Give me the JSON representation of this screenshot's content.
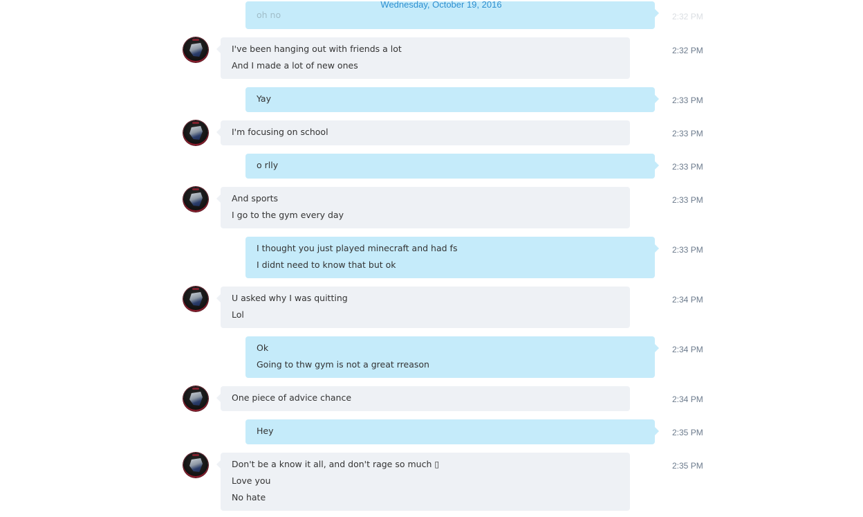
{
  "conversation": {
    "date_header": "Wednesday, October 19, 2016"
  },
  "messages": [
    {
      "dir": "out",
      "lines": [
        "oh no"
      ],
      "time": "2:32 PM"
    },
    {
      "dir": "in",
      "lines": [
        "I've been hanging out with friends a lot",
        "And I made a lot of new ones"
      ],
      "time": "2:32 PM"
    },
    {
      "dir": "out",
      "lines": [
        "Yay"
      ],
      "time": "2:33 PM"
    },
    {
      "dir": "in",
      "lines": [
        "I'm focusing on school"
      ],
      "time": "2:33 PM"
    },
    {
      "dir": "out",
      "lines": [
        "o rlly"
      ],
      "time": "2:33 PM"
    },
    {
      "dir": "in",
      "lines": [
        "And sports",
        "I go to the gym every day"
      ],
      "time": "2:33 PM"
    },
    {
      "dir": "out",
      "lines": [
        "I thought you just played minecraft and had fs",
        "I didnt need to know that but ok"
      ],
      "time": "2:33 PM"
    },
    {
      "dir": "in",
      "lines": [
        "U asked why I was quitting",
        "Lol"
      ],
      "time": "2:34 PM"
    },
    {
      "dir": "out",
      "lines": [
        "Ok",
        "Going to thw gym is not a great rreason"
      ],
      "time": "2:34 PM"
    },
    {
      "dir": "in",
      "lines": [
        "One piece of advice chance"
      ],
      "time": "2:34 PM"
    },
    {
      "dir": "out",
      "lines": [
        "Hey"
      ],
      "time": "2:35 PM"
    },
    {
      "dir": "in",
      "lines": [
        "Don't be a know it all, and don't rage so much ▯",
        "Love you",
        "No hate"
      ],
      "time": "2:35 PM"
    }
  ]
}
